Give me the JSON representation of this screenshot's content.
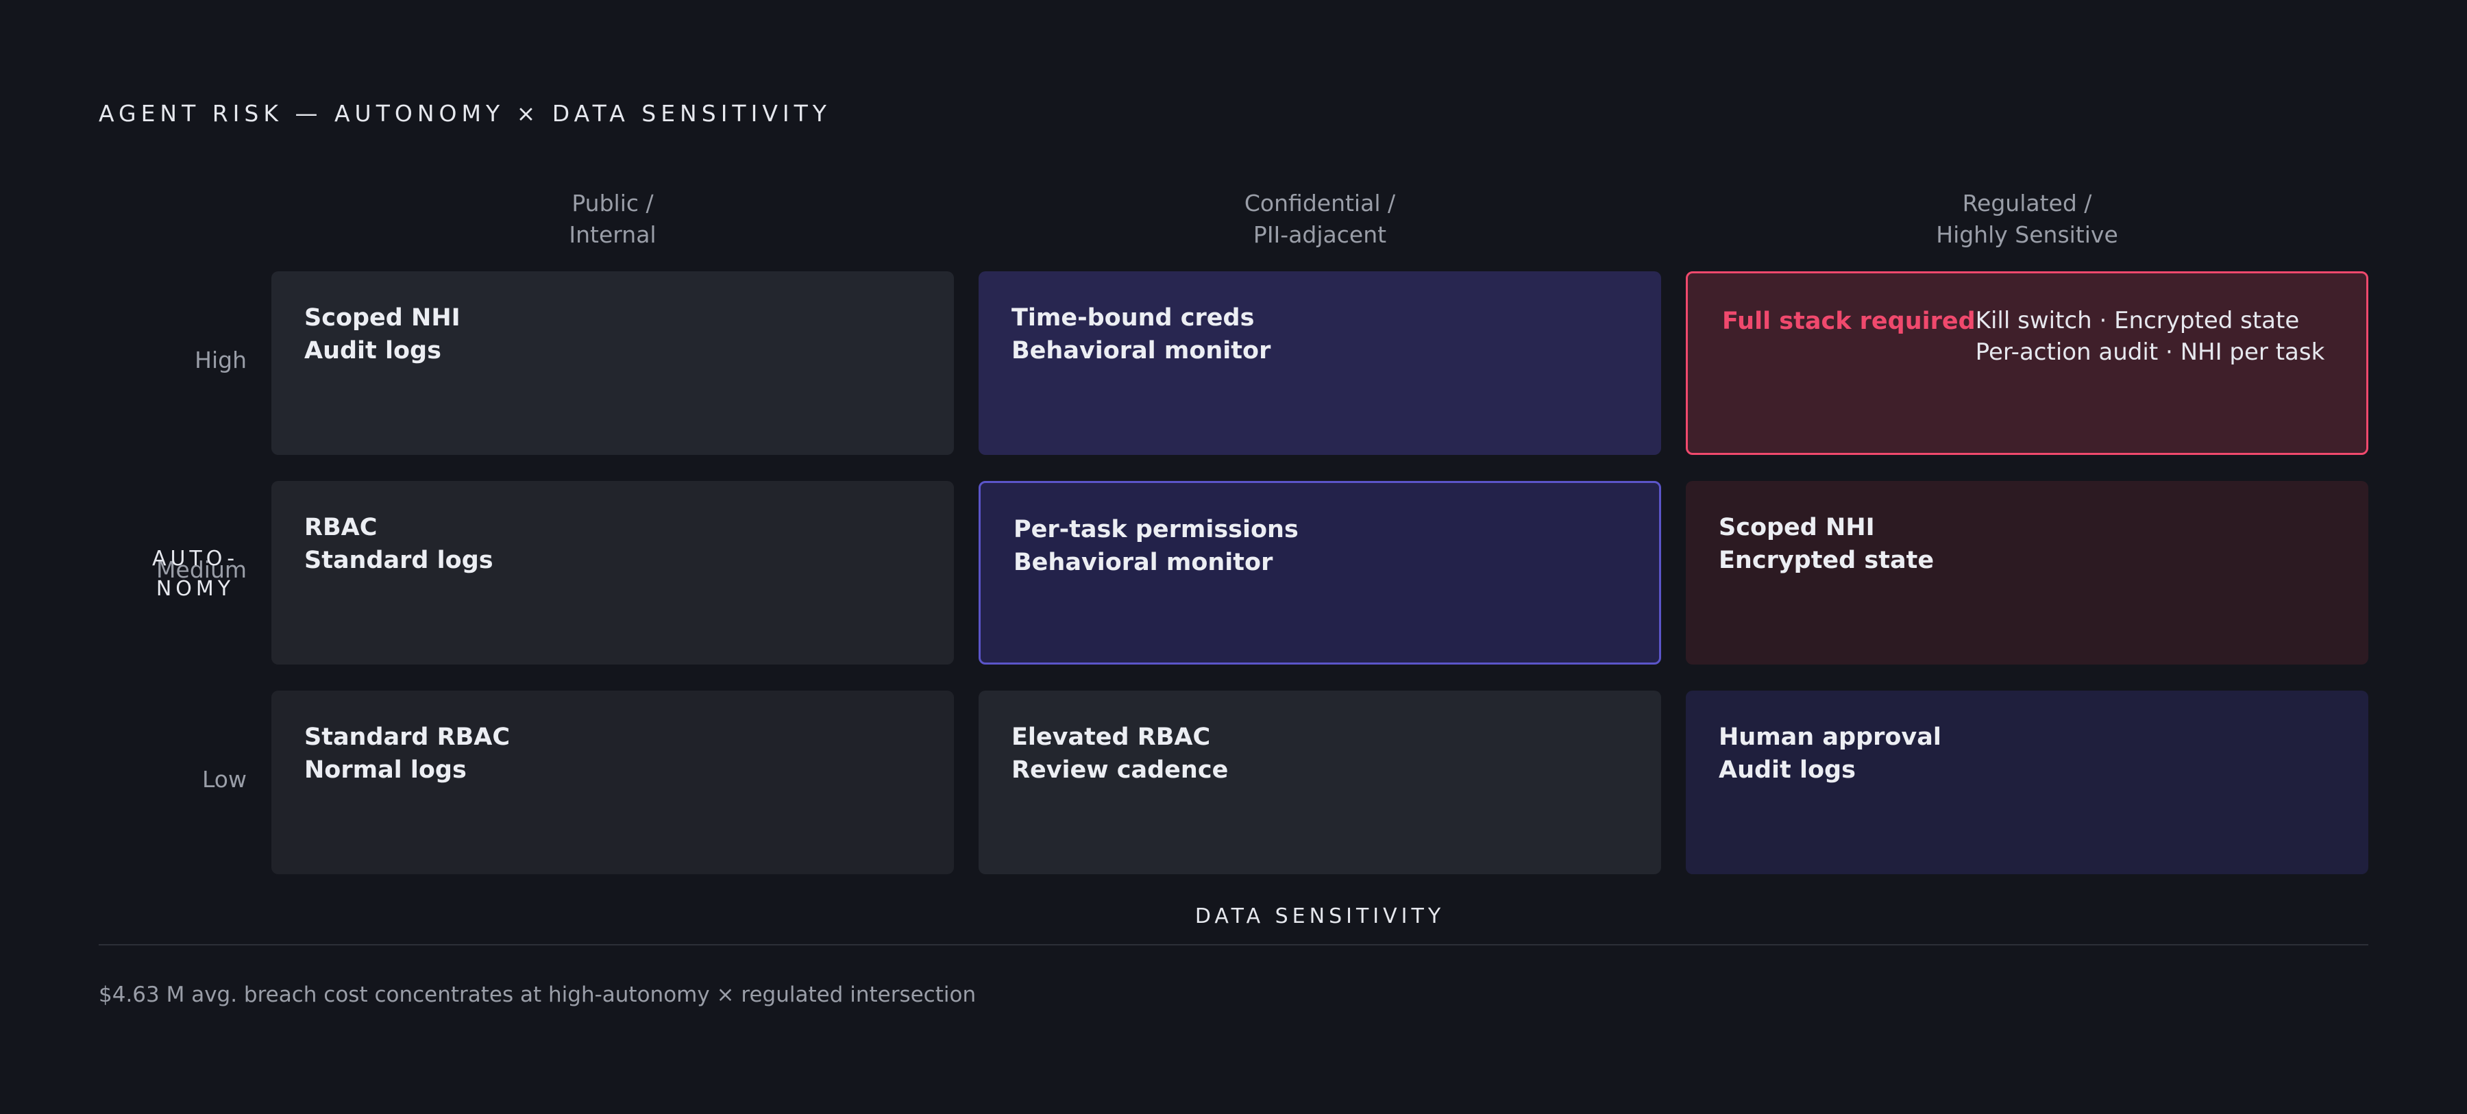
{
  "title": "AGENT RISK — AUTONOMY × DATA SENSITIVITY",
  "columns": [
    {
      "line1": "Public /",
      "line2": "Internal"
    },
    {
      "line1": "Confidential /",
      "line2": "PII-adjacent"
    },
    {
      "line1": "Regulated /",
      "line2": "Highly Sensitive"
    }
  ],
  "rows": [
    "High",
    "Medium",
    "Low"
  ],
  "y_axis": {
    "line1": "AUTO-",
    "line2": "NOMY"
  },
  "x_axis": "DATA SENSITIVITY",
  "cells": {
    "high_public": {
      "line1": "Scoped NHI",
      "line2": "Audit logs"
    },
    "high_confidential": {
      "line1": "Time-bound creds",
      "line2": "Behavioral monitor"
    },
    "high_regulated": {
      "headline": "Full stack required",
      "detail1": "Kill switch · Encrypted state",
      "detail2": "Per-action audit · NHI per task"
    },
    "medium_public": {
      "line1": "RBAC",
      "line2": "Standard logs"
    },
    "medium_confidential": {
      "line1": "Per-task permissions",
      "line2": "Behavioral monitor"
    },
    "medium_regulated": {
      "line1": "Scoped NHI",
      "line2": "Encrypted state"
    },
    "low_public": {
      "line1": "Standard RBAC",
      "line2": "Normal logs"
    },
    "low_confidential": {
      "line1": "Elevated RBAC",
      "line2": "Review cadence"
    },
    "low_regulated": {
      "line1": "Human approval",
      "line2": "Audit logs"
    }
  },
  "colors": {
    "neutral_1": "#23262e",
    "neutral_2": "#22242b",
    "indigo_1": "#282650",
    "indigo_2": "#23224a",
    "indigo_3": "#1f1f3d",
    "indigo_border": "#5b55c9",
    "danger_fill": "#3f1f2a",
    "danger_fill_2": "#2c1a22",
    "danger_border": "#f0496d",
    "highlight_text": "#f0496d"
  },
  "footnote": "$4.63 M avg. breach cost concentrates at high-autonomy × regulated intersection"
}
